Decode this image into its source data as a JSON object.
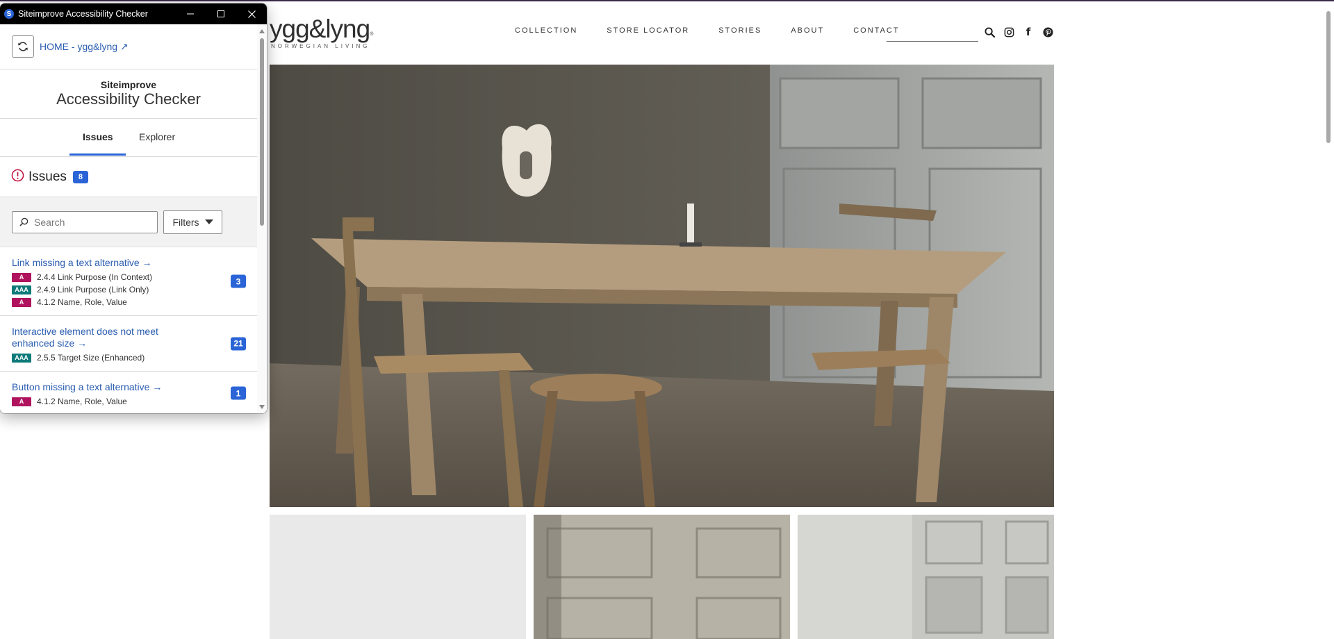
{
  "checker": {
    "window_title": "Siteimprove Accessibility Checker",
    "app_icon_letter": "S",
    "home_link": "HOME - ygg&lyng ↗",
    "brand_small": "Siteimprove",
    "brand_big": "Accessibility Checker",
    "tabs": [
      {
        "label": "Issues",
        "active": true
      },
      {
        "label": "Explorer",
        "active": false
      }
    ],
    "issues_title": "Issues",
    "issues_count": "8",
    "search_placeholder": "Search",
    "filters_label": "Filters",
    "issues": [
      {
        "title": "Link missing a text alternative →",
        "count": "3",
        "criteria": [
          {
            "level": "A",
            "text": "2.4.4 Link Purpose (In Context)"
          },
          {
            "level": "AAA",
            "text": "2.4.9 Link Purpose (Link Only)"
          },
          {
            "level": "A",
            "text": "4.1.2 Name, Role, Value"
          }
        ]
      },
      {
        "title": "Interactive element does not meet enhanced size →",
        "count": "21",
        "criteria": [
          {
            "level": "AAA",
            "text": "2.5.5 Target Size (Enhanced)"
          }
        ]
      },
      {
        "title": "Button missing a text alternative →",
        "count": "1",
        "criteria": [
          {
            "level": "A",
            "text": "4.1.2 Name, Role, Value"
          }
        ]
      }
    ],
    "colors": {
      "accent": "#2a64d6",
      "level_a": "#b0135e",
      "level_aaa": "#0e7a7a",
      "link": "#2a5db0"
    }
  },
  "site": {
    "logo_text": "ygg&lyng",
    "logo_mark": "®",
    "logo_tagline": "NORWEGIAN LIVING",
    "nav": [
      "COLLECTION",
      "STORE LOCATOR",
      "STORIES",
      "ABOUT",
      "CONTACT"
    ],
    "icons": [
      "search-icon",
      "instagram-icon",
      "facebook-icon",
      "pinterest-icon"
    ],
    "facebook_glyph": "f"
  }
}
